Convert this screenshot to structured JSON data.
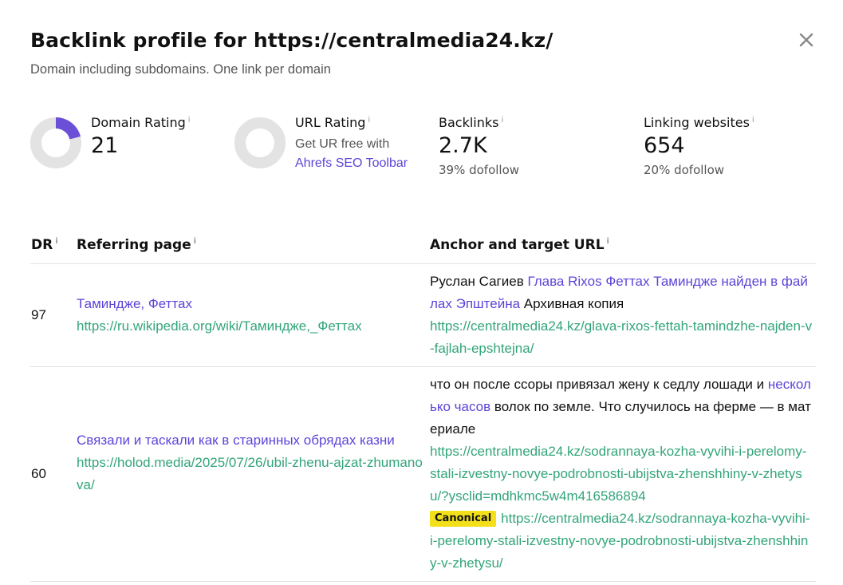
{
  "header": {
    "title": "Backlink profile for https://centralmedia24.kz/",
    "subtitle": "Domain including subdomains. One link per domain"
  },
  "metrics": {
    "domain_rating": {
      "label": "Domain Rating",
      "value": "21",
      "fill_fraction": 0.21
    },
    "url_rating": {
      "label": "URL Rating",
      "desc": "Get UR free with",
      "link": "Ahrefs SEO Toolbar"
    },
    "backlinks": {
      "label": "Backlinks",
      "value": "2.7K",
      "sub": "39% dofollow"
    },
    "linking_websites": {
      "label": "Linking websites",
      "value": "654",
      "sub": "20% dofollow"
    }
  },
  "table": {
    "headers": {
      "dr": "DR",
      "referring": "Referring page",
      "anchor": "Anchor and target URL"
    },
    "rows": [
      {
        "dr": "97",
        "ref_title": "Таминдже, Феттах",
        "ref_url": "https://ru.wikipedia.org/wiki/Таминдже,_Феттах",
        "anchor_before": "Руслан Сагиев ",
        "anchor_link": "Глава Rixos Феттах Таминдже найден в файлах Эпштейна",
        "anchor_after": " Архивная копия",
        "target_url": "https://centralmedia24.kz/glava-rixos-fettah-tamindzhe-najden-v-fajlah-epshtejna/"
      },
      {
        "dr": "60",
        "ref_title": "Связали и таскали как в старинных обрядах казни",
        "ref_url": "https://holod.media/2025/07/26/ubil-zhenu-ajzat-zhumanova/",
        "anchor_before": "что он после ссоры привязал жену к седлу лошади и ",
        "anchor_link": "несколько часов",
        "anchor_after": " волок по земле. Что случилось на ферме — в материале",
        "target_url": "https://centralmedia24.kz/sodrannaya-kozha-vyvihi-i-perelomy-stali-izvestny-novye-podrobnosti-ubijstva-zhenshhiny-v-zhetysu/?ysclid=mdhkmc5w4m416586894",
        "badge": "Canonical",
        "canonical_url": "https://centralmedia24.kz/sodrannaya-kozha-vyvihi-i-perelomy-stali-izvestny-novye-podrobnosti-ubijstva-zhenshhiny-v-zhetysu/"
      }
    ]
  },
  "colors": {
    "accent": "#5b45d8",
    "url_green": "#33a57a",
    "donut_track": "#e3e3e3",
    "badge_yellow": "#f3e01a"
  },
  "icons": {
    "close": "close-icon",
    "info": "info-icon"
  }
}
